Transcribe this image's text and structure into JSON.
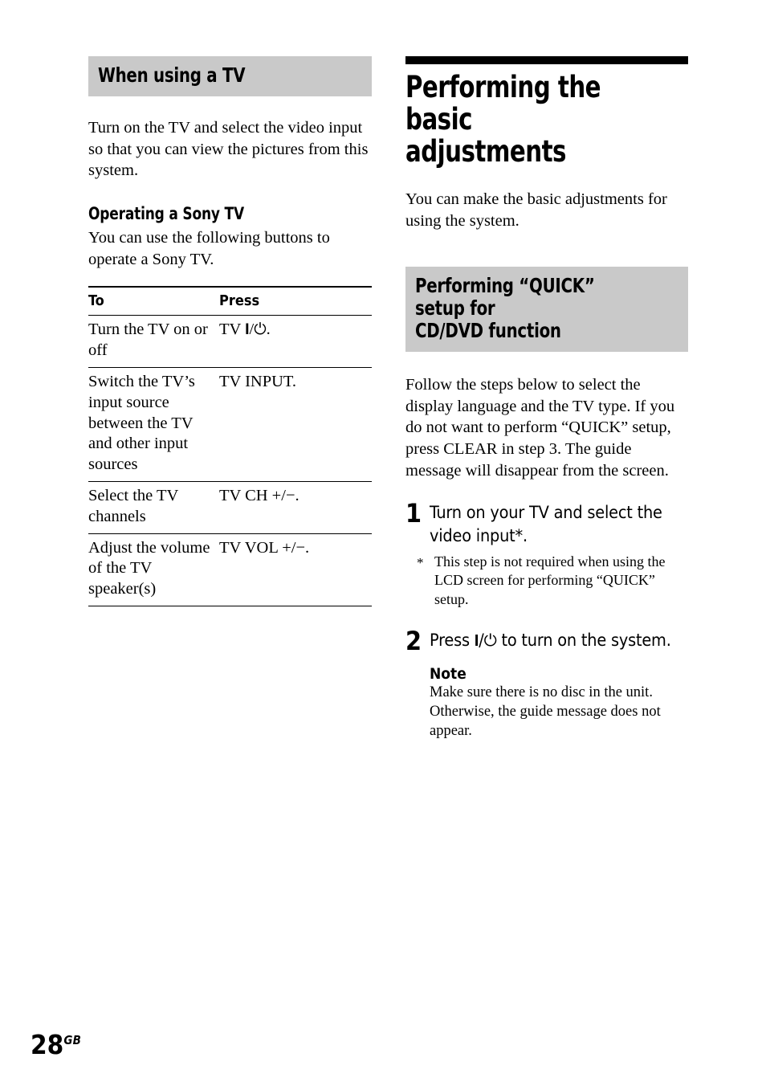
{
  "page": {
    "number": "28",
    "region_code": "GB"
  },
  "left_column": {
    "section_heading": "When using a TV",
    "intro_paragraph": "Turn on the TV and select the video input so that you can view the pictures from this system.",
    "sub_heading": "Operating a Sony TV",
    "sub_paragraph": "You can use the following buttons to operate a Sony TV.",
    "table": {
      "headers": [
        "To",
        "Press"
      ],
      "rows": [
        {
          "to": "Turn the TV on or off",
          "press_prefix": "TV ",
          "press_symbol": "power-symbol",
          "press_suffix": "."
        },
        {
          "to": "Switch the TV’s input source between the TV and other input sources",
          "press_prefix": "TV INPUT.",
          "press_symbol": "",
          "press_suffix": ""
        },
        {
          "to": "Select the TV channels",
          "press_prefix": "TV CH +/−.",
          "press_symbol": "",
          "press_suffix": ""
        },
        {
          "to": "Adjust the volume of the TV speaker(s)",
          "press_prefix": "TV VOL +/−.",
          "press_symbol": "",
          "press_suffix": ""
        }
      ]
    }
  },
  "right_column": {
    "chapter_title": "Performing the basic\nadjustments",
    "chapter_intro": "You can make the basic adjustments for using the system.",
    "section_heading": "Performing “QUICK” setup for\nCD/DVD function",
    "section_intro": "Follow the steps below to select the display language and the TV type. If you do not want to perform “QUICK” setup, press CLEAR in step 3. The guide message will disappear from the screen.",
    "steps": [
      {
        "number": "1",
        "text": "Turn on your TV and select the video input*.",
        "footnote_mark": "*",
        "footnote_text": "This step is not required when using the LCD screen for performing “QUICK” setup."
      },
      {
        "number": "2",
        "text_before_symbol": "Press ",
        "symbol": "power-symbol",
        "text_after_symbol": " to turn on the system.",
        "note_title": "Note",
        "note_text": "Make sure there is no disc in the unit. Otherwise, the guide message does not appear."
      }
    ]
  },
  "symbols": {
    "power_bar": "I",
    "power_slash": "/",
    "power_circle": "⏻"
  },
  "colors": {
    "band_gray": "#c9c9c9",
    "rule_black": "#000000",
    "page_background": "#ffffff"
  }
}
